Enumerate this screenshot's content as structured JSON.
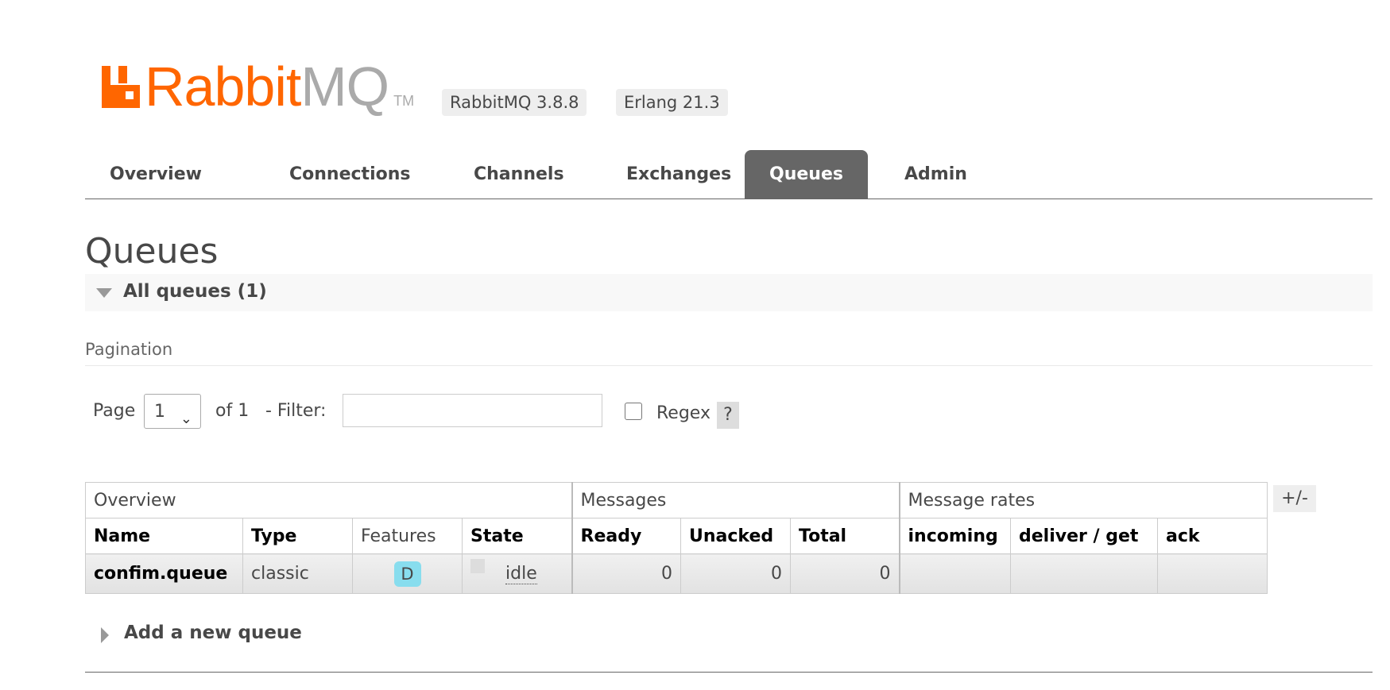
{
  "header": {
    "logo_text_1": "Rabbit",
    "logo_text_2": "MQ",
    "logo_tm": "TM",
    "version": "RabbitMQ 3.8.8",
    "erlang": "Erlang 21.3",
    "brand_color": "#ff6600"
  },
  "nav": {
    "tabs": [
      "Overview",
      "Connections",
      "Channels",
      "Exchanges",
      "Queues",
      "Admin"
    ],
    "active": "Queues"
  },
  "page_title": "Queues",
  "section": {
    "label": "All queues (1)"
  },
  "pagination": {
    "label": "Pagination",
    "page_label": "Page",
    "page_value": "1",
    "of_label": "of 1",
    "filter_label": "- Filter:",
    "filter_value": "",
    "regex_label": "Regex",
    "regex_checked": false,
    "help_label": "?"
  },
  "table": {
    "groups": [
      "Overview",
      "Messages",
      "Message rates"
    ],
    "columns": [
      "Name",
      "Type",
      "Features",
      "State",
      "Ready",
      "Unacked",
      "Total",
      "incoming",
      "deliver / get",
      "ack"
    ],
    "rows": [
      {
        "name": "confim.queue",
        "type": "classic",
        "features": "D",
        "state": "idle",
        "ready": "0",
        "unacked": "0",
        "total": "0",
        "incoming": "",
        "deliver_get": "",
        "ack": ""
      }
    ],
    "toggle_columns_label": "+/-"
  },
  "add_queue": {
    "label": "Add a new queue"
  }
}
